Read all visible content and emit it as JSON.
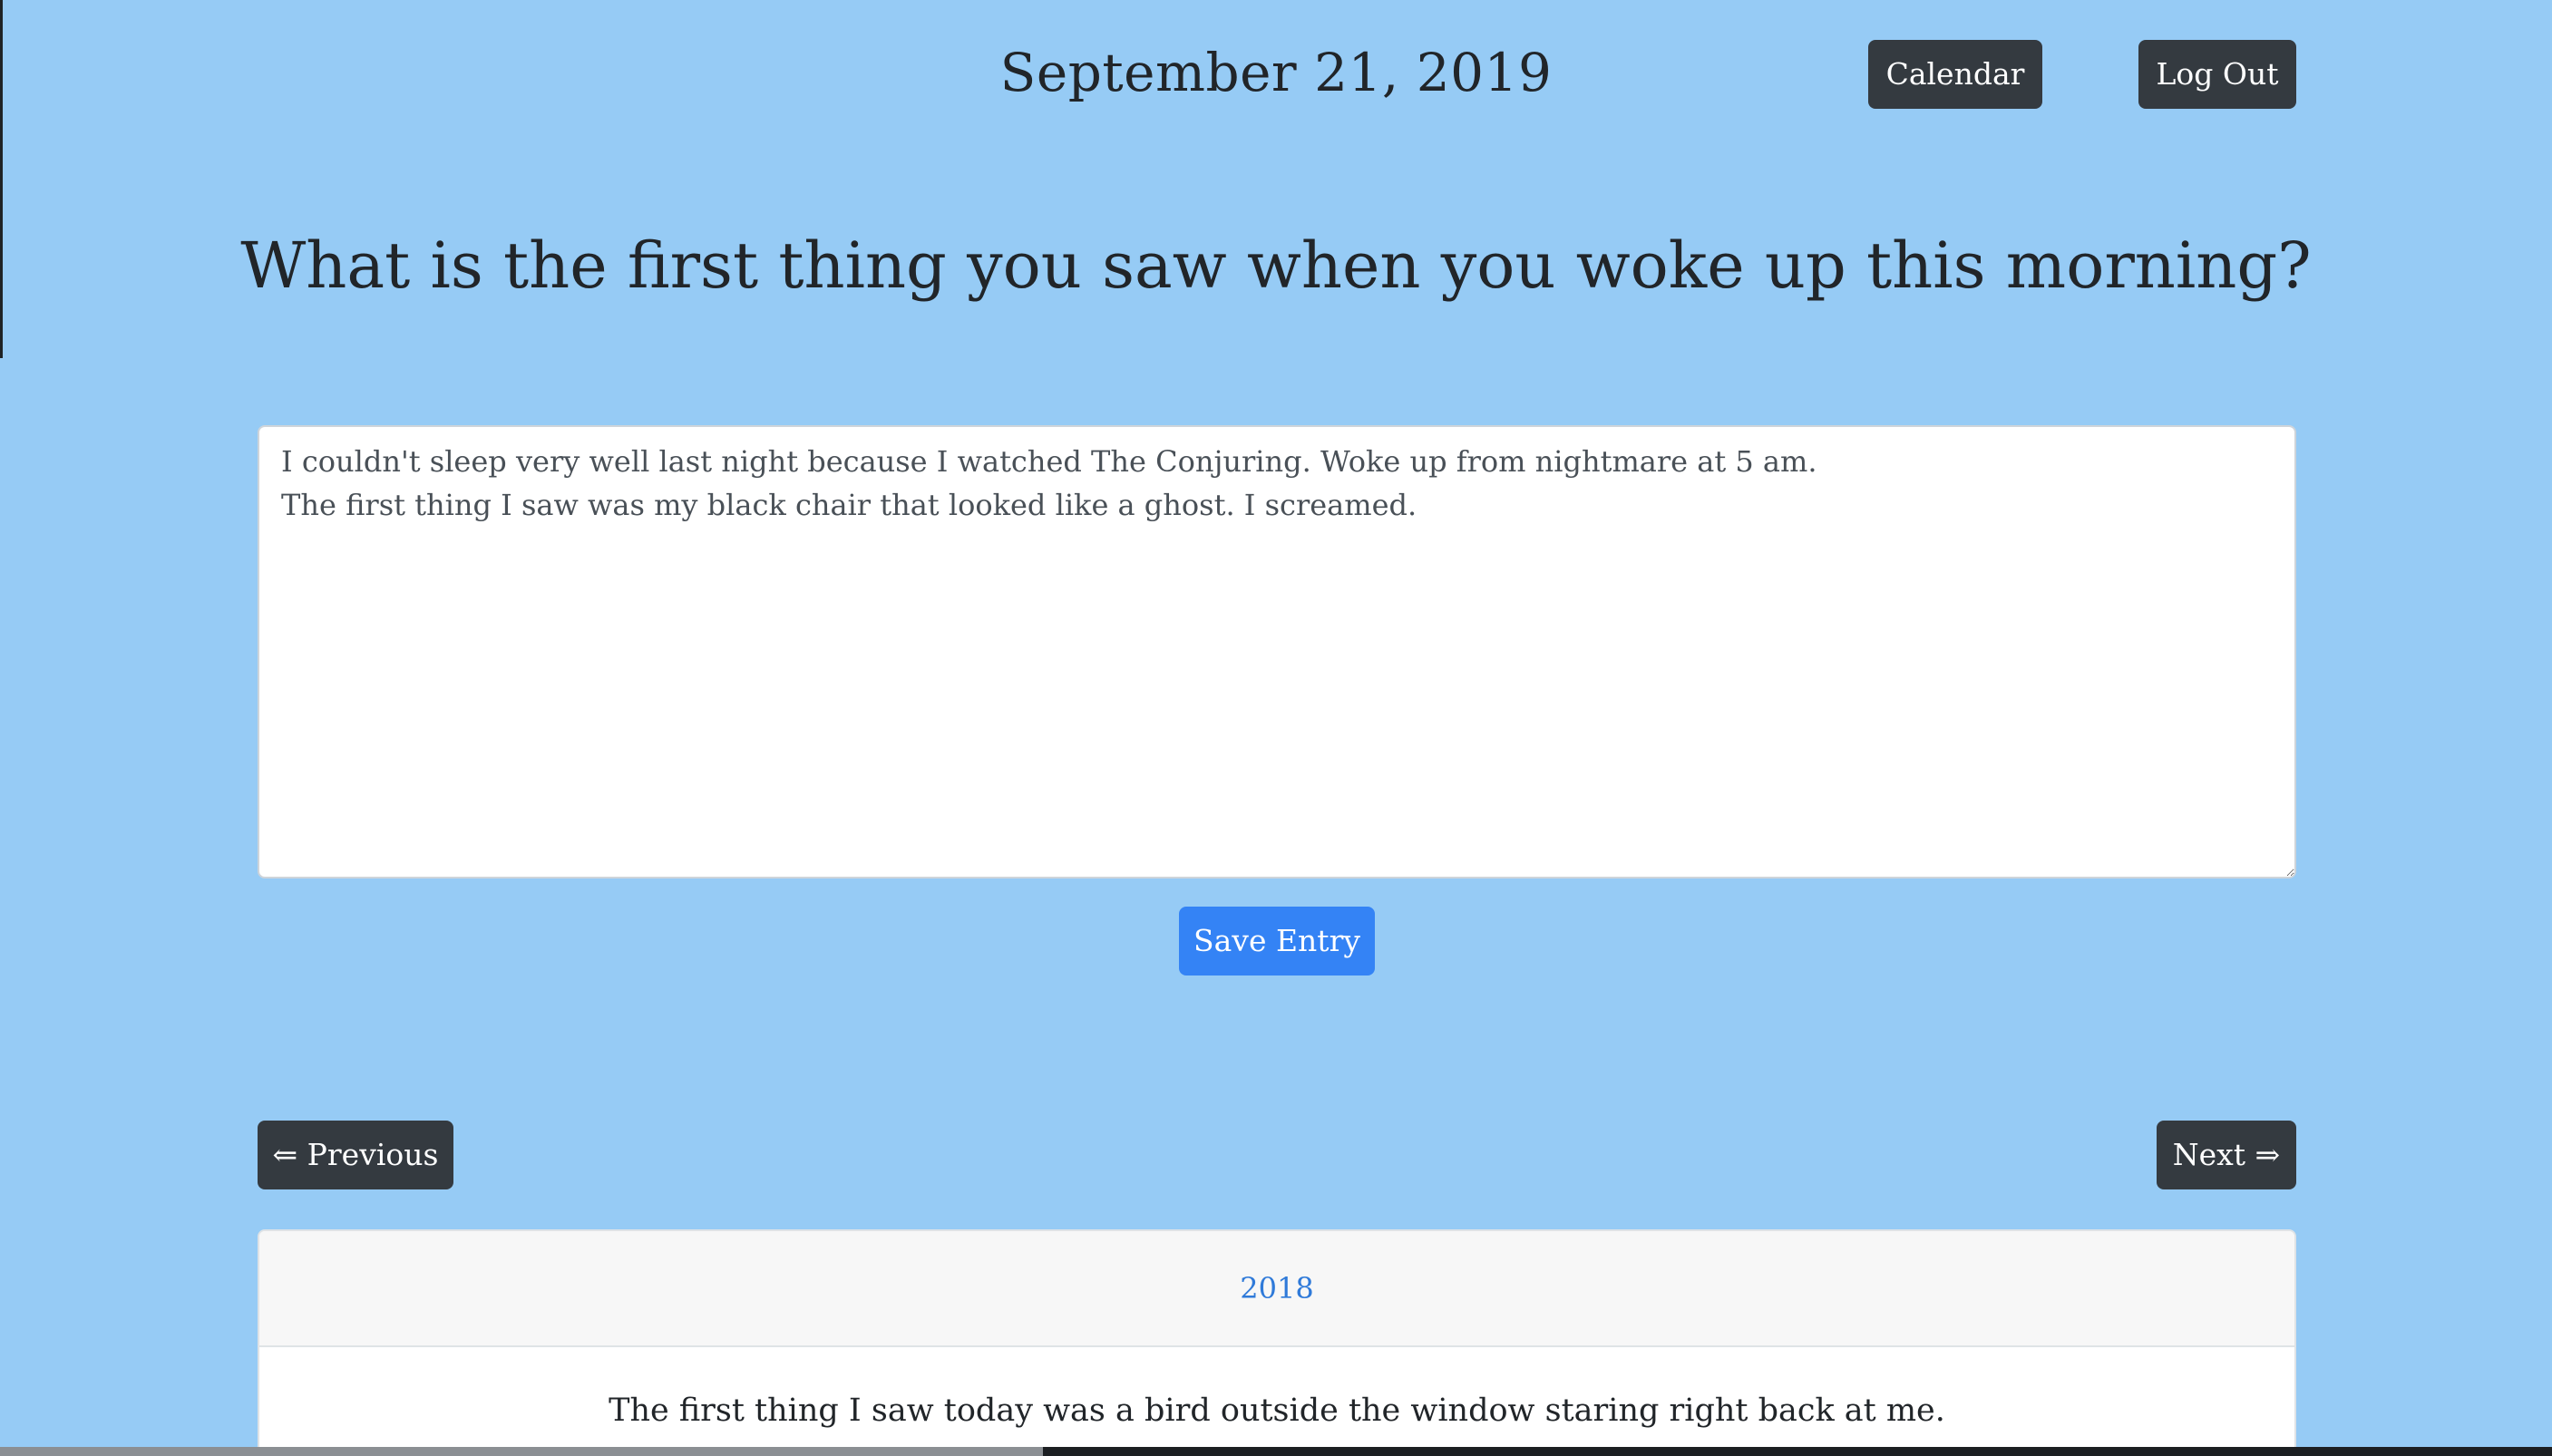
{
  "header": {
    "date": "September 21, 2019",
    "calendar_label": "Calendar",
    "logout_label": "Log Out"
  },
  "prompt": {
    "question": "What is the first thing you saw when you woke up this morning?"
  },
  "entry": {
    "value": "I couldn't sleep very well last night because I watched The Conjuring. Woke up from nightmare at 5 am.\nThe first thing I saw was my black chair that looked like a ghost. I screamed."
  },
  "actions": {
    "save_label": "Save Entry"
  },
  "navigation": {
    "previous_label": "⇐ Previous",
    "next_label": "Next ⇒"
  },
  "past_entry": {
    "year": "2018",
    "text": "The first thing I saw today was a bird outside the window staring right back at me."
  },
  "colors": {
    "background": "#96cbf5",
    "dark_button": "#343a40",
    "primary_button": "#3483f5",
    "link": "#2f7ad9"
  }
}
